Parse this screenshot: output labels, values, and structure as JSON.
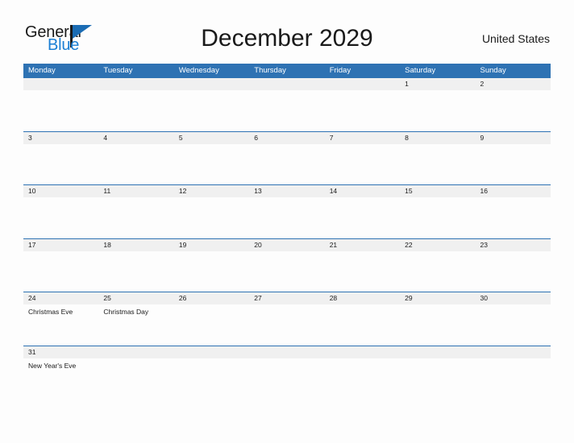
{
  "brand": {
    "name_part1": "General",
    "name_part2": "Blue",
    "flag_icon": "triangle-flag-icon",
    "accent_color": "#1b7fd4"
  },
  "header": {
    "title": "December 2029",
    "country": "United States"
  },
  "theme": {
    "header_blue": "#2e72b3",
    "band_gray": "#f0f0f0",
    "page_background": "#fdfdfd",
    "text_color": "#1a1a1a"
  },
  "calendar": {
    "month": "December",
    "year": "2029",
    "first_day_of_week": "Monday",
    "day_headers": [
      "Monday",
      "Tuesday",
      "Wednesday",
      "Thursday",
      "Friday",
      "Saturday",
      "Sunday"
    ],
    "weeks": [
      {
        "days": [
          {
            "num": "",
            "event": ""
          },
          {
            "num": "",
            "event": ""
          },
          {
            "num": "",
            "event": ""
          },
          {
            "num": "",
            "event": ""
          },
          {
            "num": "",
            "event": ""
          },
          {
            "num": "1",
            "event": ""
          },
          {
            "num": "2",
            "event": ""
          }
        ]
      },
      {
        "days": [
          {
            "num": "3",
            "event": ""
          },
          {
            "num": "4",
            "event": ""
          },
          {
            "num": "5",
            "event": ""
          },
          {
            "num": "6",
            "event": ""
          },
          {
            "num": "7",
            "event": ""
          },
          {
            "num": "8",
            "event": ""
          },
          {
            "num": "9",
            "event": ""
          }
        ]
      },
      {
        "days": [
          {
            "num": "10",
            "event": ""
          },
          {
            "num": "11",
            "event": ""
          },
          {
            "num": "12",
            "event": ""
          },
          {
            "num": "13",
            "event": ""
          },
          {
            "num": "14",
            "event": ""
          },
          {
            "num": "15",
            "event": ""
          },
          {
            "num": "16",
            "event": ""
          }
        ]
      },
      {
        "days": [
          {
            "num": "17",
            "event": ""
          },
          {
            "num": "18",
            "event": ""
          },
          {
            "num": "19",
            "event": ""
          },
          {
            "num": "20",
            "event": ""
          },
          {
            "num": "21",
            "event": ""
          },
          {
            "num": "22",
            "event": ""
          },
          {
            "num": "23",
            "event": ""
          }
        ]
      },
      {
        "days": [
          {
            "num": "24",
            "event": "Christmas Eve"
          },
          {
            "num": "25",
            "event": "Christmas Day"
          },
          {
            "num": "26",
            "event": ""
          },
          {
            "num": "27",
            "event": ""
          },
          {
            "num": "28",
            "event": ""
          },
          {
            "num": "29",
            "event": ""
          },
          {
            "num": "30",
            "event": ""
          }
        ]
      },
      {
        "days": [
          {
            "num": "31",
            "event": "New Year's Eve"
          },
          {
            "num": "",
            "event": ""
          },
          {
            "num": "",
            "event": ""
          },
          {
            "num": "",
            "event": ""
          },
          {
            "num": "",
            "event": ""
          },
          {
            "num": "",
            "event": ""
          },
          {
            "num": "",
            "event": ""
          }
        ]
      }
    ]
  }
}
